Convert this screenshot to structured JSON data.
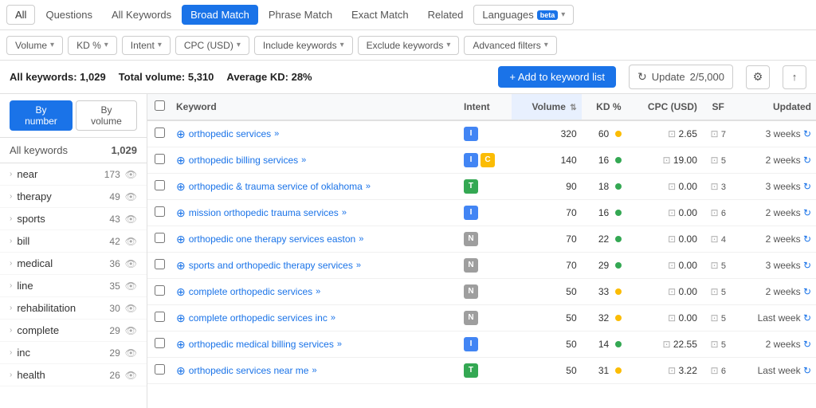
{
  "tabs": [
    {
      "label": "All",
      "active": false,
      "id": "all"
    },
    {
      "label": "Questions",
      "active": false,
      "id": "questions"
    },
    {
      "label": "All Keywords",
      "active": false,
      "id": "all-keywords"
    },
    {
      "label": "Broad Match",
      "active": true,
      "id": "broad-match"
    },
    {
      "label": "Phrase Match",
      "active": false,
      "id": "phrase-match"
    },
    {
      "label": "Exact Match",
      "active": false,
      "id": "exact-match"
    },
    {
      "label": "Related",
      "active": false,
      "id": "related"
    }
  ],
  "lang_btn": "Languages",
  "filters": [
    {
      "label": "Volume",
      "id": "volume"
    },
    {
      "label": "KD %",
      "id": "kd"
    },
    {
      "label": "Intent",
      "id": "intent"
    },
    {
      "label": "CPC (USD)",
      "id": "cpc"
    },
    {
      "label": "Include keywords",
      "id": "include"
    },
    {
      "label": "Exclude keywords",
      "id": "exclude"
    },
    {
      "label": "Advanced filters",
      "id": "advanced"
    }
  ],
  "summary": {
    "all_keywords_label": "All keywords:",
    "all_keywords_value": "1,029",
    "total_volume_label": "Total volume:",
    "total_volume_value": "5,310",
    "avg_kd_label": "Average KD:",
    "avg_kd_value": "28%",
    "add_btn": "+ Add to keyword list",
    "update_btn": "Update",
    "update_count": "2/5,000"
  },
  "view_toggle": {
    "by_number": "By number",
    "by_volume": "By volume"
  },
  "sidebar_header": {
    "label": "All keywords",
    "count": "1,029"
  },
  "sidebar_items": [
    {
      "label": "near",
      "count": 173
    },
    {
      "label": "therapy",
      "count": 49
    },
    {
      "label": "sports",
      "count": 43
    },
    {
      "label": "bill",
      "count": 42
    },
    {
      "label": "medical",
      "count": 36
    },
    {
      "label": "line",
      "count": 35
    },
    {
      "label": "rehabilitation",
      "count": 30
    },
    {
      "label": "complete",
      "count": 29
    },
    {
      "label": "inc",
      "count": 29
    },
    {
      "label": "health",
      "count": 26
    }
  ],
  "table_headers": [
    {
      "label": "",
      "id": "checkbox"
    },
    {
      "label": "Keyword",
      "id": "keyword"
    },
    {
      "label": "Intent",
      "id": "intent"
    },
    {
      "label": "Volume",
      "id": "volume",
      "sorted": true
    },
    {
      "label": "KD %",
      "id": "kd"
    },
    {
      "label": "CPC (USD)",
      "id": "cpc"
    },
    {
      "label": "SF",
      "id": "sf"
    },
    {
      "label": "Updated",
      "id": "updated"
    }
  ],
  "rows": [
    {
      "keyword": "orthopedic services",
      "intent": "I",
      "intent2": null,
      "volume": 320,
      "kd": 60,
      "kd_color": "orange",
      "cpc": "2.65",
      "sf": 7,
      "updated": "3 weeks"
    },
    {
      "keyword": "orthopedic billing services",
      "intent": "I",
      "intent2": "C",
      "volume": 140,
      "kd": 16,
      "kd_color": "green",
      "cpc": "19.00",
      "sf": 5,
      "updated": "2 weeks"
    },
    {
      "keyword": "orthopedic & trauma service of oklahoma",
      "intent": "T",
      "intent2": null,
      "volume": 90,
      "kd": 18,
      "kd_color": "green",
      "cpc": "0.00",
      "sf": 3,
      "updated": "3 weeks"
    },
    {
      "keyword": "mission orthopedic trauma services",
      "intent": "I",
      "intent2": null,
      "volume": 70,
      "kd": 16,
      "kd_color": "green",
      "cpc": "0.00",
      "sf": 6,
      "updated": "2 weeks"
    },
    {
      "keyword": "orthopedic one therapy services easton",
      "intent": "N",
      "intent2": null,
      "volume": 70,
      "kd": 22,
      "kd_color": "green",
      "cpc": "0.00",
      "sf": 4,
      "updated": "2 weeks"
    },
    {
      "keyword": "sports and orthopedic therapy services",
      "intent": "N",
      "intent2": null,
      "volume": 70,
      "kd": 29,
      "kd_color": "green",
      "cpc": "0.00",
      "sf": 5,
      "updated": "3 weeks"
    },
    {
      "keyword": "complete orthopedic services",
      "intent": "N",
      "intent2": null,
      "volume": 50,
      "kd": 33,
      "kd_color": "orange",
      "cpc": "0.00",
      "sf": 5,
      "updated": "2 weeks"
    },
    {
      "keyword": "complete orthopedic services inc",
      "intent": "N",
      "intent2": null,
      "volume": 50,
      "kd": 32,
      "kd_color": "orange",
      "cpc": "0.00",
      "sf": 5,
      "updated": "Last week"
    },
    {
      "keyword": "orthopedic medical billing services",
      "intent": "I",
      "intent2": null,
      "volume": 50,
      "kd": 14,
      "kd_color": "green",
      "cpc": "22.55",
      "sf": 5,
      "updated": "2 weeks"
    },
    {
      "keyword": "orthopedic services near me",
      "intent": "T",
      "intent2": null,
      "volume": 50,
      "kd": 31,
      "kd_color": "orange",
      "cpc": "3.22",
      "sf": 6,
      "updated": "Last week"
    }
  ]
}
